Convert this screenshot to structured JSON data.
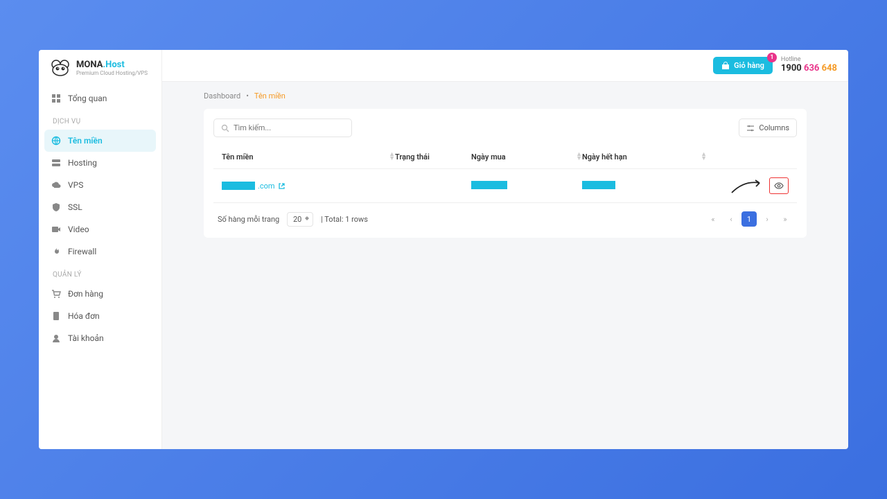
{
  "logo": {
    "brand1": "MONA",
    "brand2": ".Host",
    "tagline": "Premium Cloud Hosting/VPS"
  },
  "topbar": {
    "cart_label": "Giỏ hàng",
    "cart_count": "1",
    "hotline_label": "Hotline",
    "hotline_p1": "1900 ",
    "hotline_p2": "636 ",
    "hotline_p3": "648"
  },
  "nav": {
    "overview": "Tổng quan",
    "section_service": "DỊCH VỤ",
    "domain": "Tên miền",
    "hosting": "Hosting",
    "vps": "VPS",
    "ssl": "SSL",
    "video": "Video",
    "firewall": "Firewall",
    "section_manage": "QUẢN LÝ",
    "orders": "Đơn hàng",
    "invoices": "Hóa đơn",
    "account": "Tài khoản"
  },
  "breadcrumb": {
    "root": "Dashboard",
    "sep": "•",
    "current": "Tên miền"
  },
  "search": {
    "placeholder": "Tìm kiếm..."
  },
  "columns_btn": "Columns",
  "headers": {
    "domain": "Tên miền",
    "status": "Trạng thái",
    "purchase": "Ngày mua",
    "expire": "Ngày hết hạn"
  },
  "row": {
    "domain_suffix": ".com"
  },
  "footer": {
    "rows_label": "Số hàng mỗi trang",
    "rows_value": "20",
    "total": "| Total: 1 rows",
    "page": "1"
  }
}
